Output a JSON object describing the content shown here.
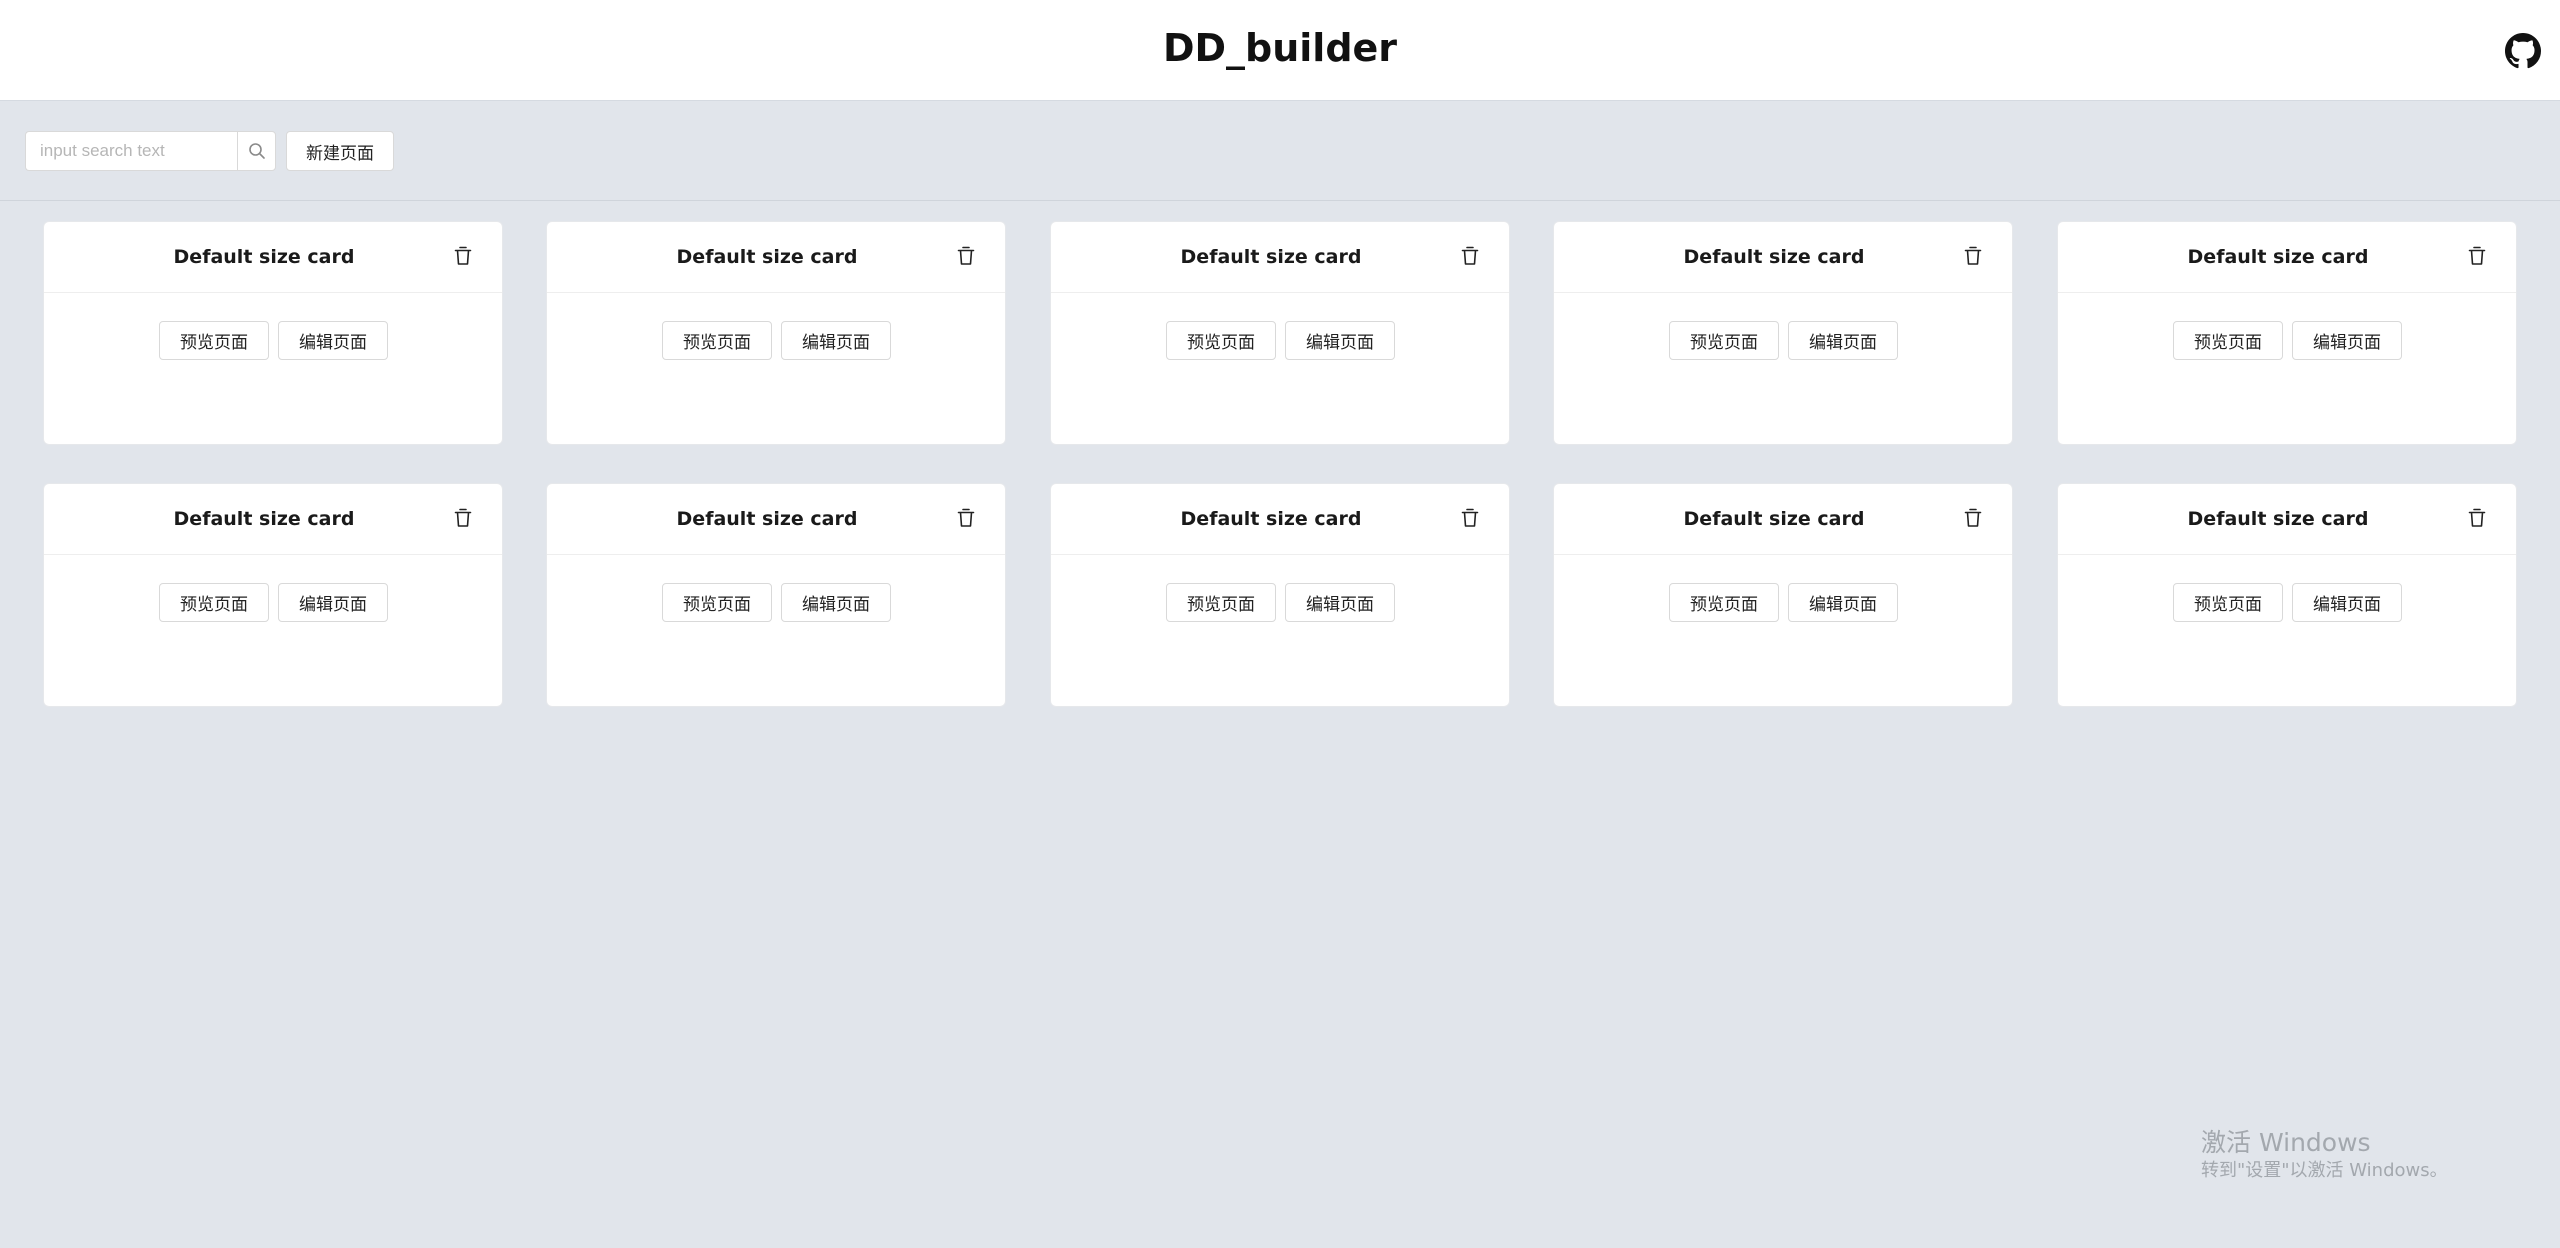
{
  "app": {
    "title": "DD_builder",
    "github_icon": "github-icon"
  },
  "toolbar": {
    "search_placeholder": "input search text",
    "search_value": "",
    "search_icon": "search-icon",
    "new_page_label": "新建页面"
  },
  "cards": [
    {
      "title": "Default size card",
      "preview_label": "预览页面",
      "edit_label": "编辑页面",
      "delete_icon": "trash-icon"
    },
    {
      "title": "Default size card",
      "preview_label": "预览页面",
      "edit_label": "编辑页面",
      "delete_icon": "trash-icon"
    },
    {
      "title": "Default size card",
      "preview_label": "预览页面",
      "edit_label": "编辑页面",
      "delete_icon": "trash-icon"
    },
    {
      "title": "Default size card",
      "preview_label": "预览页面",
      "edit_label": "编辑页面",
      "delete_icon": "trash-icon"
    },
    {
      "title": "Default size card",
      "preview_label": "预览页面",
      "edit_label": "编辑页面",
      "delete_icon": "trash-icon"
    },
    {
      "title": "Default size card",
      "preview_label": "预览页面",
      "edit_label": "编辑页面",
      "delete_icon": "trash-icon"
    },
    {
      "title": "Default size card",
      "preview_label": "预览页面",
      "edit_label": "编辑页面",
      "delete_icon": "trash-icon"
    },
    {
      "title": "Default size card",
      "preview_label": "预览页面",
      "edit_label": "编辑页面",
      "delete_icon": "trash-icon"
    },
    {
      "title": "Default size card",
      "preview_label": "预览页面",
      "edit_label": "编辑页面",
      "delete_icon": "trash-icon"
    },
    {
      "title": "Default size card",
      "preview_label": "预览页面",
      "edit_label": "编辑页面",
      "delete_icon": "trash-icon"
    }
  ],
  "watermark": {
    "line1": "激活 Windows",
    "line2": "转到\"设置\"以激活 Windows。"
  },
  "colors": {
    "background": "#e1e5eb",
    "header": "#ffffff",
    "card": "#ffffff",
    "border": "#d9d9d9"
  }
}
